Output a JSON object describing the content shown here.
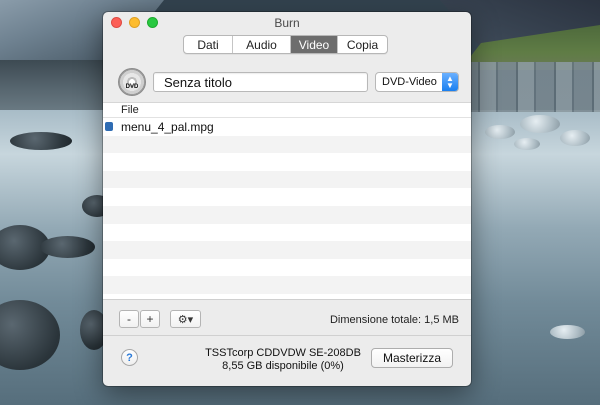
{
  "window": {
    "title": "Burn"
  },
  "tabs": [
    {
      "label": "Dati",
      "selected": false
    },
    {
      "label": "Audio",
      "selected": false
    },
    {
      "label": "Video",
      "selected": true
    },
    {
      "label": "Copia",
      "selected": false
    }
  ],
  "disc": {
    "icon": "dvd-disc-icon",
    "icon_label": "DVD",
    "title_value": "Senza titolo",
    "format": "DVD-Video"
  },
  "file_list": {
    "column_header": "File",
    "rows": [
      {
        "name": "menu_4_pal.mpg",
        "icon": "video-file-icon"
      }
    ]
  },
  "toolbar": {
    "remove_label": "-",
    "add_label": "+",
    "actions_label": "⚙▾",
    "total_size": "Dimensione totale: 1,5 MB"
  },
  "footer": {
    "help_label": "?",
    "drive_name": "TSSTcorp CDDVDW SE-208DB",
    "drive_space": "8,55 GB disponibile (0%)",
    "burn_label": "Masterizza"
  },
  "colors": {
    "selected_tab": "#6d6d6d",
    "accent_blue": "#1a7ff0",
    "close": "#fc5f57",
    "minimize": "#fdbc2e",
    "zoom": "#28c840"
  }
}
